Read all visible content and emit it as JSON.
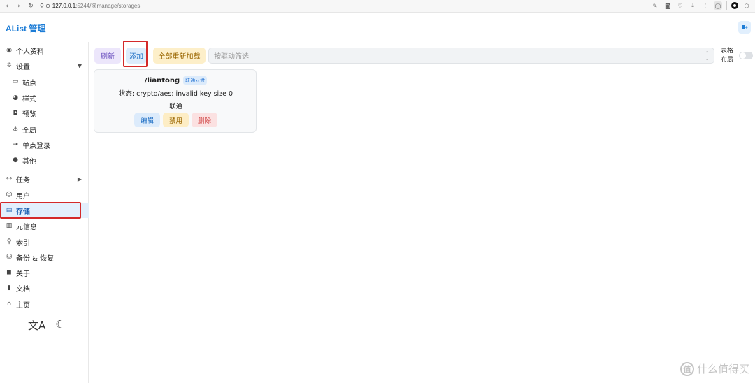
{
  "browser": {
    "url_host": "127.0.0.1",
    "url_path": ":5244/@manage/storages"
  },
  "header": {
    "title": "AList 管理"
  },
  "sidebar": {
    "items": [
      {
        "label": "个人资料",
        "icon": "fingerprint-icon"
      },
      {
        "label": "设置",
        "icon": "gear-icon",
        "expanded": true
      },
      {
        "label": "站点",
        "icon": "window-icon",
        "sub": true
      },
      {
        "label": "样式",
        "icon": "palette-icon",
        "sub": true
      },
      {
        "label": "预览",
        "icon": "camera-icon",
        "sub": true
      },
      {
        "label": "全局",
        "icon": "anchor-icon",
        "sub": true
      },
      {
        "label": "单点登录",
        "icon": "login-icon",
        "sub": true
      },
      {
        "label": "其他",
        "icon": "ellipsis-icon",
        "sub": true
      },
      {
        "label": "任务",
        "icon": "route-icon",
        "collapsed": true
      },
      {
        "label": "用户",
        "icon": "user-circle-icon"
      },
      {
        "label": "存储",
        "icon": "database-icon",
        "active": true
      },
      {
        "label": "元信息",
        "icon": "metadata-icon"
      },
      {
        "label": "索引",
        "icon": "search-icon"
      },
      {
        "label": "备份 & 恢复",
        "icon": "database-backup-icon"
      },
      {
        "label": "关于",
        "icon": "chat-icon"
      },
      {
        "label": "文档",
        "icon": "book-icon"
      },
      {
        "label": "主页",
        "icon": "home-icon"
      }
    ],
    "footer": {
      "language_glyph": "文A",
      "theme_glyph": "☾"
    }
  },
  "toolbar": {
    "refresh_label": "刷新",
    "add_label": "添加",
    "reload_all_label": "全部重新加载",
    "filter_placeholder": "按驱动筛选",
    "layout_label": "表格布局",
    "table_layout_enabled": false
  },
  "storages": [
    {
      "mount_path": "/liantong",
      "driver": "联通云盘",
      "status": "状态: crypto/aes: invalid key size 0",
      "remark": "联通",
      "actions": {
        "edit": "编辑",
        "disable": "禁用",
        "delete": "删除"
      }
    }
  ],
  "watermark": {
    "text": "什么值得买",
    "logo_glyph": "值"
  },
  "colors": {
    "brand": "#1c7cd6",
    "active_bg": "#e3effc",
    "highlight_red": "#d42a2a"
  }
}
